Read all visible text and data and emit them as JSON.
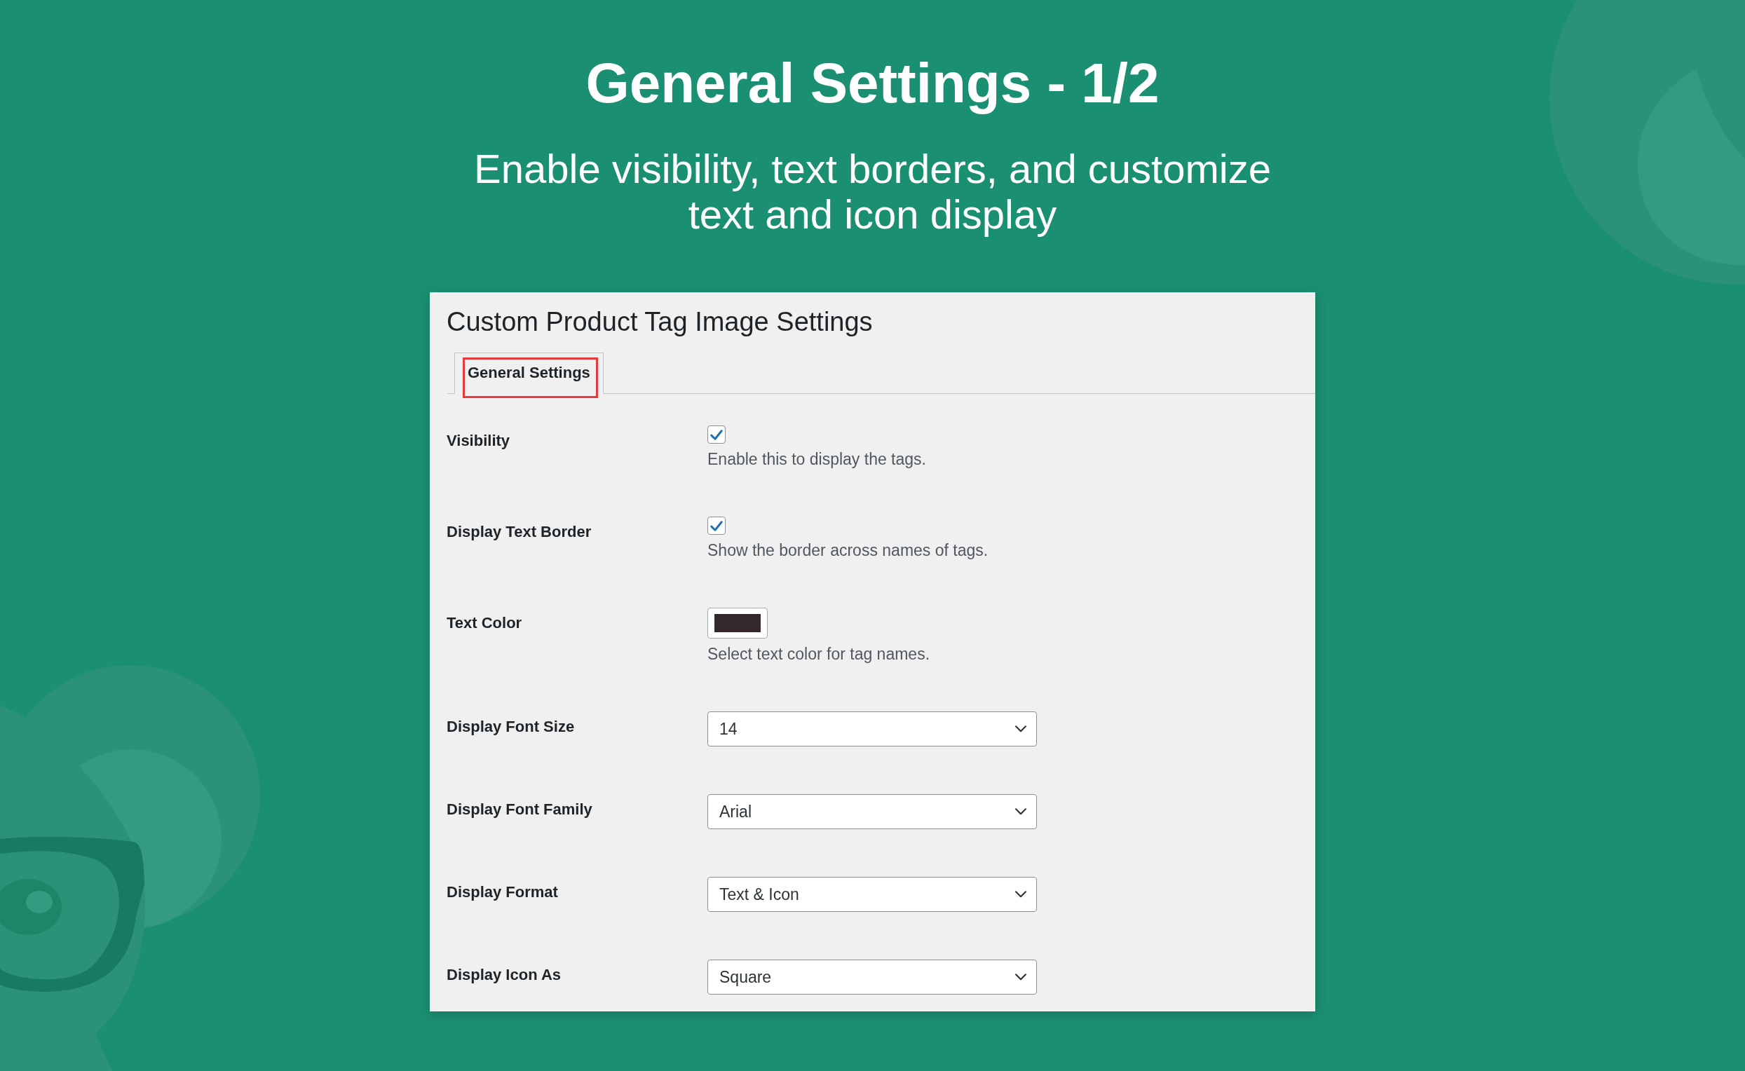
{
  "header": {
    "title": "General Settings - 1/2",
    "subtitle": "Enable visibility, text borders, and customize text and icon display"
  },
  "settings_page": {
    "title": "Custom Product Tag Image Settings",
    "tabs": [
      {
        "label": "General Settings",
        "selected": true,
        "highlighted": true
      }
    ],
    "fields": [
      {
        "kind": "checkbox",
        "label": "Visibility",
        "checked": true,
        "description": "Enable this to display the tags."
      },
      {
        "kind": "checkbox",
        "label": "Display Text Border",
        "checked": true,
        "description": "Show the border across names of tags."
      },
      {
        "kind": "color",
        "label": "Text Color",
        "color": "#35282b",
        "description": "Select text color for tag names."
      },
      {
        "kind": "select",
        "label": "Display Font Size",
        "value": "14"
      },
      {
        "kind": "select",
        "label": "Display Font Family",
        "value": "Arial"
      },
      {
        "kind": "select",
        "label": "Display Format",
        "value": "Text & Icon"
      },
      {
        "kind": "select",
        "label": "Display Icon As",
        "value": "Square"
      }
    ]
  }
}
